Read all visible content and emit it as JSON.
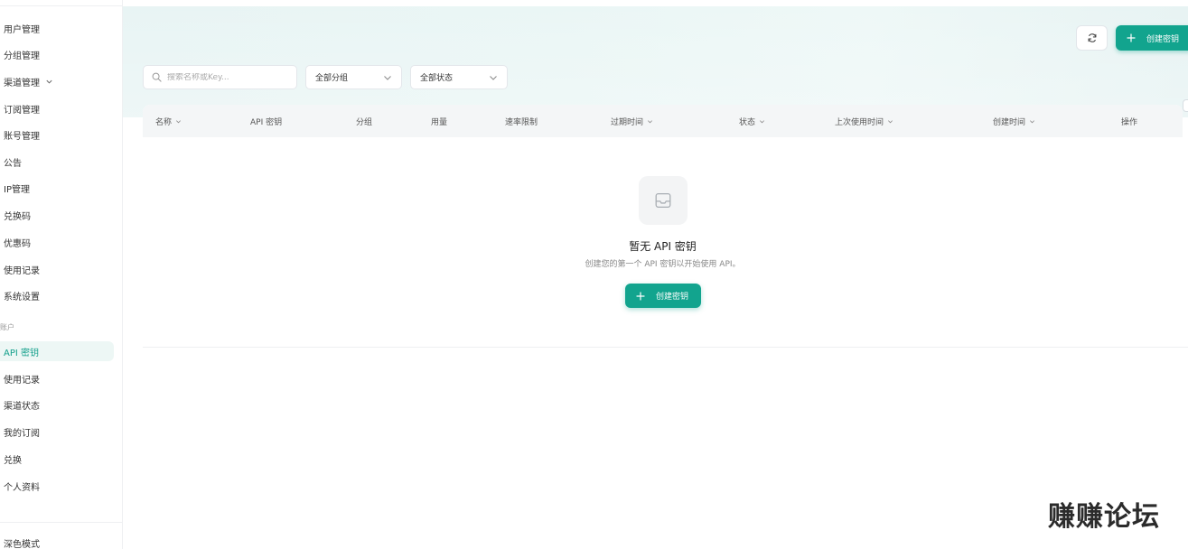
{
  "sidebar": {
    "admin_items": [
      {
        "label": "用户管理",
        "has_chevron": false
      },
      {
        "label": "分组管理",
        "has_chevron": false
      },
      {
        "label": "渠道管理",
        "has_chevron": true
      },
      {
        "label": "订阅管理",
        "has_chevron": false
      },
      {
        "label": "账号管理",
        "has_chevron": false
      },
      {
        "label": "公告",
        "has_chevron": false
      },
      {
        "label": "IP管理",
        "has_chevron": false
      },
      {
        "label": "兑换码",
        "has_chevron": false
      },
      {
        "label": "优惠码",
        "has_chevron": false
      },
      {
        "label": "使用记录",
        "has_chevron": false
      },
      {
        "label": "系统设置",
        "has_chevron": false
      }
    ],
    "section_label": "账户",
    "user_items": [
      {
        "label": "API 密钥",
        "active": true
      },
      {
        "label": "使用记录",
        "active": false
      },
      {
        "label": "渠道状态",
        "active": false
      },
      {
        "label": "我的订阅",
        "active": false
      },
      {
        "label": "兑换",
        "active": false
      },
      {
        "label": "个人资料",
        "active": false
      }
    ],
    "dark_mode_label": "深色模式"
  },
  "toolbar": {
    "refresh_icon": "refresh-icon",
    "create_label": "创建密钥",
    "search_placeholder": "搜索名称或Key...",
    "group_filter": "全部分组",
    "status_filter": "全部状态"
  },
  "table": {
    "columns": [
      {
        "label": "名称",
        "sortable": true
      },
      {
        "label": "API 密钥",
        "sortable": false
      },
      {
        "label": "分组",
        "sortable": false
      },
      {
        "label": "用量",
        "sortable": false
      },
      {
        "label": "速率限制",
        "sortable": false
      },
      {
        "label": "过期时间",
        "sortable": true
      },
      {
        "label": "状态",
        "sortable": true
      },
      {
        "label": "上次使用时间",
        "sortable": true
      },
      {
        "label": "创建时间",
        "sortable": true
      },
      {
        "label": "操作",
        "sortable": false
      }
    ],
    "empty": {
      "icon": "inbox-icon",
      "title": "暂无 API 密钥",
      "description": "创建您的第一个 API 密钥以开始使用 API。",
      "create_label": "创建密钥"
    }
  },
  "watermark": "赚赚论坛",
  "colors": {
    "accent": "#12a48e",
    "active_bg": "#edf7f5"
  }
}
